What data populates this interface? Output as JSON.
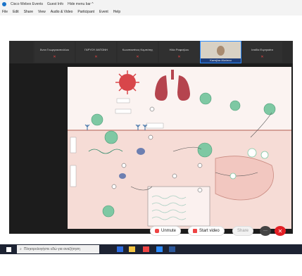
{
  "titlebar": {
    "app": "Cisco Webex Events",
    "guest_info": "Guest Info",
    "hide_menu_bar": "Hide menu bar ^"
  },
  "menu": [
    "File",
    "Edit",
    "Share",
    "View",
    "Audio & Video",
    "Participant",
    "Event",
    "Help"
  ],
  "participants": [
    {
      "name": "Άννα Γεωργακοπούλου",
      "muted": true
    },
    {
      "name": "ΓΑΡΥΟΥ ΑΝΤΩΝΗ",
      "muted": true
    },
    {
      "name": "Κωνσταντίνος Κομπότης",
      "muted": true
    },
    {
      "name": "Ηλία Ραφαήλου",
      "muted": true
    },
    {
      "name": "Καπήλια Αλεύτου",
      "muted": false,
      "active": true
    },
    {
      "name": "Ισαδία Ευρηκαίτα",
      "muted": true
    }
  ],
  "controls": {
    "unmute": "Unmute",
    "start_video": "Start video",
    "share": "Share",
    "more": "···",
    "leave": "✕"
  },
  "taskbar": {
    "search_placeholder": "Πληκτρολογήστε εδώ για αναζήτηση"
  },
  "colors": {
    "stage_bg": "#1c1c1c",
    "slide_bg": "#fbf3f1",
    "accent": "#2d8cff",
    "leave": "#e31e24",
    "virus": "#7ec8a3",
    "lungs": "#b5444e"
  }
}
